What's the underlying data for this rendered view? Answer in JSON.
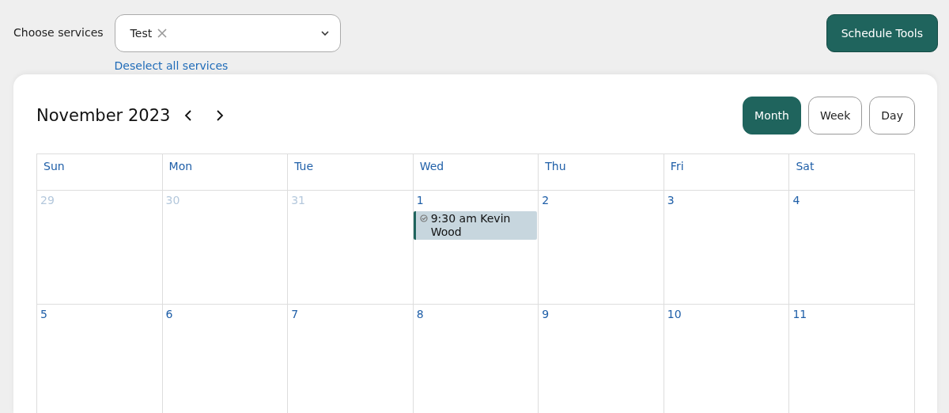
{
  "filter": {
    "label": "Choose services",
    "chips": [
      {
        "label": "Test"
      }
    ],
    "deselect_link": "Deselect all services"
  },
  "tools_button": "Schedule Tools",
  "calendar": {
    "title": "November 2023",
    "views": [
      {
        "label": "Month",
        "selected": true
      },
      {
        "label": "Week",
        "selected": false
      },
      {
        "label": "Day",
        "selected": false
      }
    ],
    "weekdays": [
      "Sun",
      "Mon",
      "Tue",
      "Wed",
      "Thu",
      "Fri",
      "Sat"
    ],
    "weeks": [
      [
        {
          "day": "29",
          "other_month": true
        },
        {
          "day": "30",
          "other_month": true
        },
        {
          "day": "31",
          "other_month": true
        },
        {
          "day": "1",
          "other_month": false,
          "events": [
            {
              "text": "9:30 am Kevin Wood"
            }
          ]
        },
        {
          "day": "2",
          "other_month": false
        },
        {
          "day": "3",
          "other_month": false
        },
        {
          "day": "4",
          "other_month": false
        }
      ],
      [
        {
          "day": "5",
          "other_month": false
        },
        {
          "day": "6",
          "other_month": false
        },
        {
          "day": "7",
          "other_month": false
        },
        {
          "day": "8",
          "other_month": false
        },
        {
          "day": "9",
          "other_month": false
        },
        {
          "day": "10",
          "other_month": false
        },
        {
          "day": "11",
          "other_month": false
        }
      ]
    ]
  }
}
